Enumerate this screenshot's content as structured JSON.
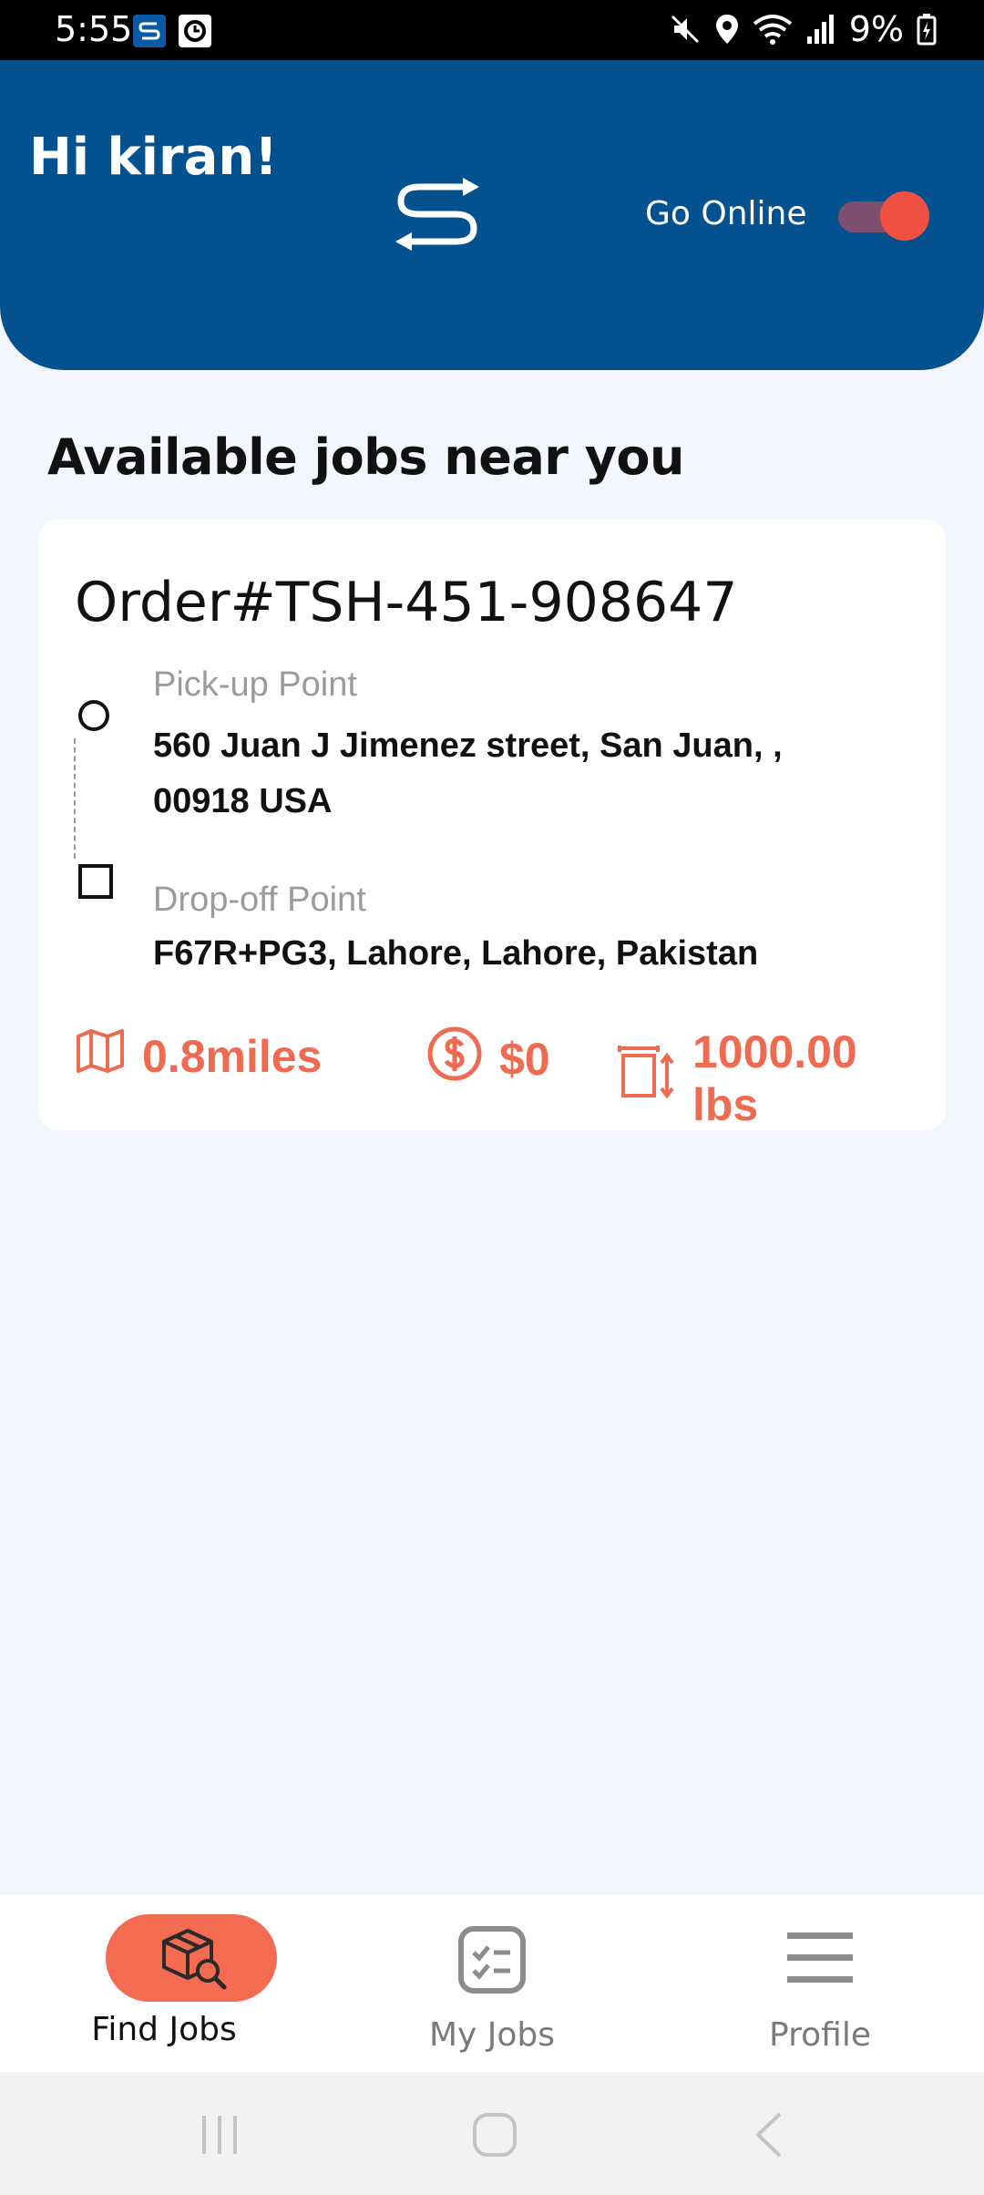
{
  "status_bar": {
    "time": "5:55",
    "battery": "9%"
  },
  "header": {
    "greeting": "Hi kiran!",
    "online_label": "Go Online"
  },
  "section_title": "Available jobs near you",
  "job": {
    "order": "Order#TSH-451-908647",
    "pickup_label": "Pick-up Point",
    "pickup_address": "560 Juan J Jimenez street, San Juan,  , 00918 USA",
    "dropoff_label": "Drop-off Point",
    "dropoff_address": "F67R+PG3, Lahore, Lahore,  Pakistan",
    "distance": "0.8miles",
    "price": "$0",
    "weight": "1000.00 lbs"
  },
  "nav": {
    "items": [
      {
        "label": "Find Jobs",
        "icon": "box-search-icon",
        "active": true
      },
      {
        "label": "My Jobs",
        "icon": "checklist-icon",
        "active": false
      },
      {
        "label": "Profile",
        "icon": "menu-icon",
        "active": false
      }
    ]
  },
  "colors": {
    "header_blue": "#03528f",
    "accent": "#ee6a50",
    "toggle_knob": "#f05143",
    "background": "#f4f6fd"
  }
}
